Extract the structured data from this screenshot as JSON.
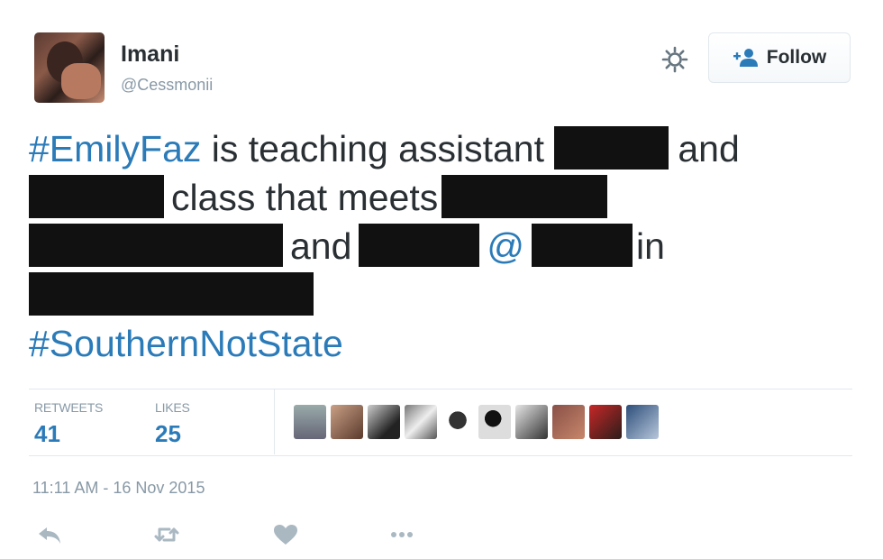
{
  "user": {
    "name": "Imani",
    "handle": "@Cessmonii"
  },
  "follow_button": {
    "label": "Follow"
  },
  "tweet": {
    "hashtag_1": "#EmilyFaz",
    "text_1": " is teaching assistant ",
    "text_2": "and",
    "text_3": "class that meets",
    "text_4": "and",
    "at_symbol": "@",
    "text_5": "in",
    "hashtag_2": "#SouthernNotState"
  },
  "stats": {
    "retweets_label": "RETWEETS",
    "retweets_count": "41",
    "likes_label": "LIKES",
    "likes_count": "25"
  },
  "liker_avatars": 11,
  "timestamp": "11:11 AM - 16 Nov 2015",
  "icons": {
    "settings": "gear-icon",
    "follow": "add-user-icon",
    "reply": "reply-icon",
    "retweet": "retweet-icon",
    "like": "heart-icon",
    "more": "more-icon"
  },
  "colors": {
    "link": "#2b7bb9",
    "text": "#292f33",
    "muted": "#8899a6",
    "redaction": "#111111"
  }
}
